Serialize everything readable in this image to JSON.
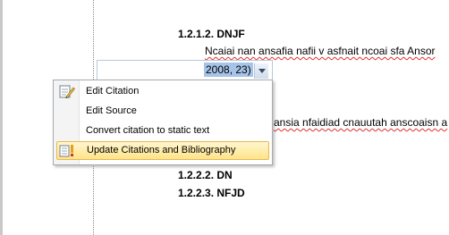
{
  "document": {
    "heading_1": "1.2.1.2. DNJF",
    "paragraph_1": "Ncaiai nan ansafia nafii v asfnait ncoai sfa Ansor",
    "citation_text": "2008, 23)",
    "paragraph_2": "ansia nfaidiad cnauutah anscoaisn a",
    "heading_2": "1.2.2.2. DN",
    "heading_3": "1.2.2.3. NFJD"
  },
  "context_menu": {
    "items": [
      {
        "label": "Edit Citation",
        "icon": "edit-citation-icon"
      },
      {
        "label": "Edit Source",
        "icon": null
      },
      {
        "label": "Convert citation to static text",
        "icon": null
      },
      {
        "label": "Update Citations and Bibliography",
        "icon": "update-citations-icon",
        "highlighted": true
      }
    ]
  },
  "colors": {
    "selection": "#a6c4e8",
    "menu_highlight": "#ffe48a",
    "spellcheck": "#e03030"
  }
}
